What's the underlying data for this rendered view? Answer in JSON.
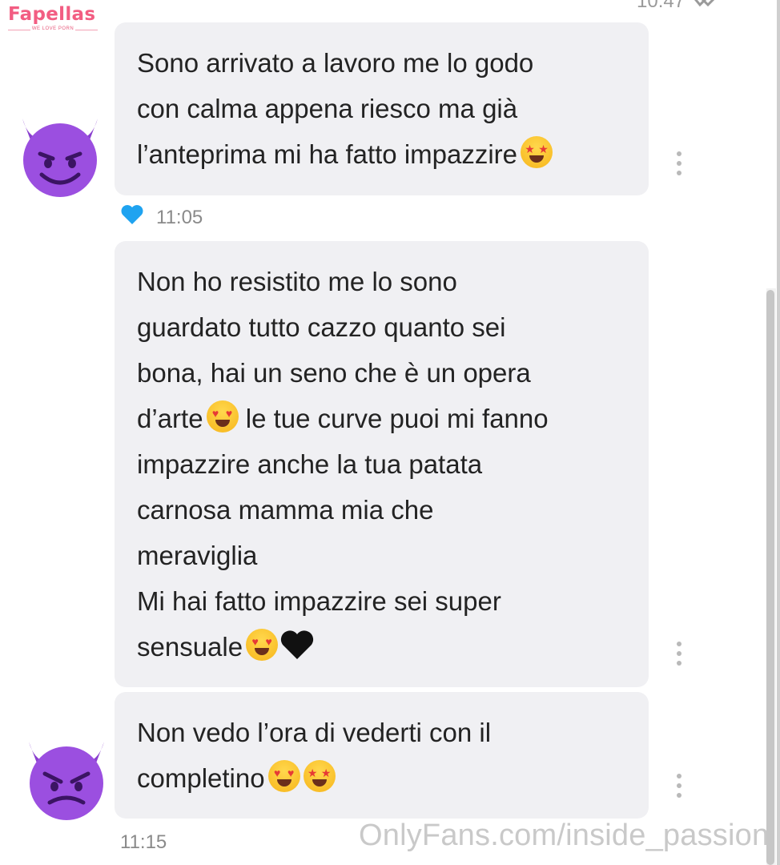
{
  "brand": {
    "logo_text": "Fapellas",
    "logo_tagline": "WE LOVE PORN"
  },
  "header": {
    "previous_time": "10:47"
  },
  "messages": [
    {
      "text": "Sono arrivato a lavoro me lo godo\ncon calma appena riesco ma già\nl’anteprima mi ha fatto impazzire",
      "emojis": [
        "star-struck"
      ],
      "liked": true,
      "time": "11:05"
    },
    {
      "text": "Non ho resistito me lo sono\nguardato tutto cazzo quanto sei\nbona, hai un seno che è un opera\nd’arte",
      "text_after_emoji": " le tue curve puoi mi fanno\nimpazzire anche la tua patata\ncarnosa mamma mia che\nmeraviglia\nMi hai fatto impazzire sei super\nsensuale",
      "emojis": [
        "heart-eyes",
        "heart-eyes",
        "black-heart"
      ]
    },
    {
      "text": "Non vedo l’ora di vederti con il\ncompletino",
      "emojis": [
        "heart-eyes",
        "star-struck"
      ],
      "time": "11:15"
    }
  ],
  "watermark": "OnlyFans.com/inside_passion",
  "colors": {
    "bubble_bg": "#f0f0f3",
    "like_heart": "#1fa3f0",
    "brand_pink": "#f25d82",
    "avatar_purple": "#8a3fcf"
  }
}
